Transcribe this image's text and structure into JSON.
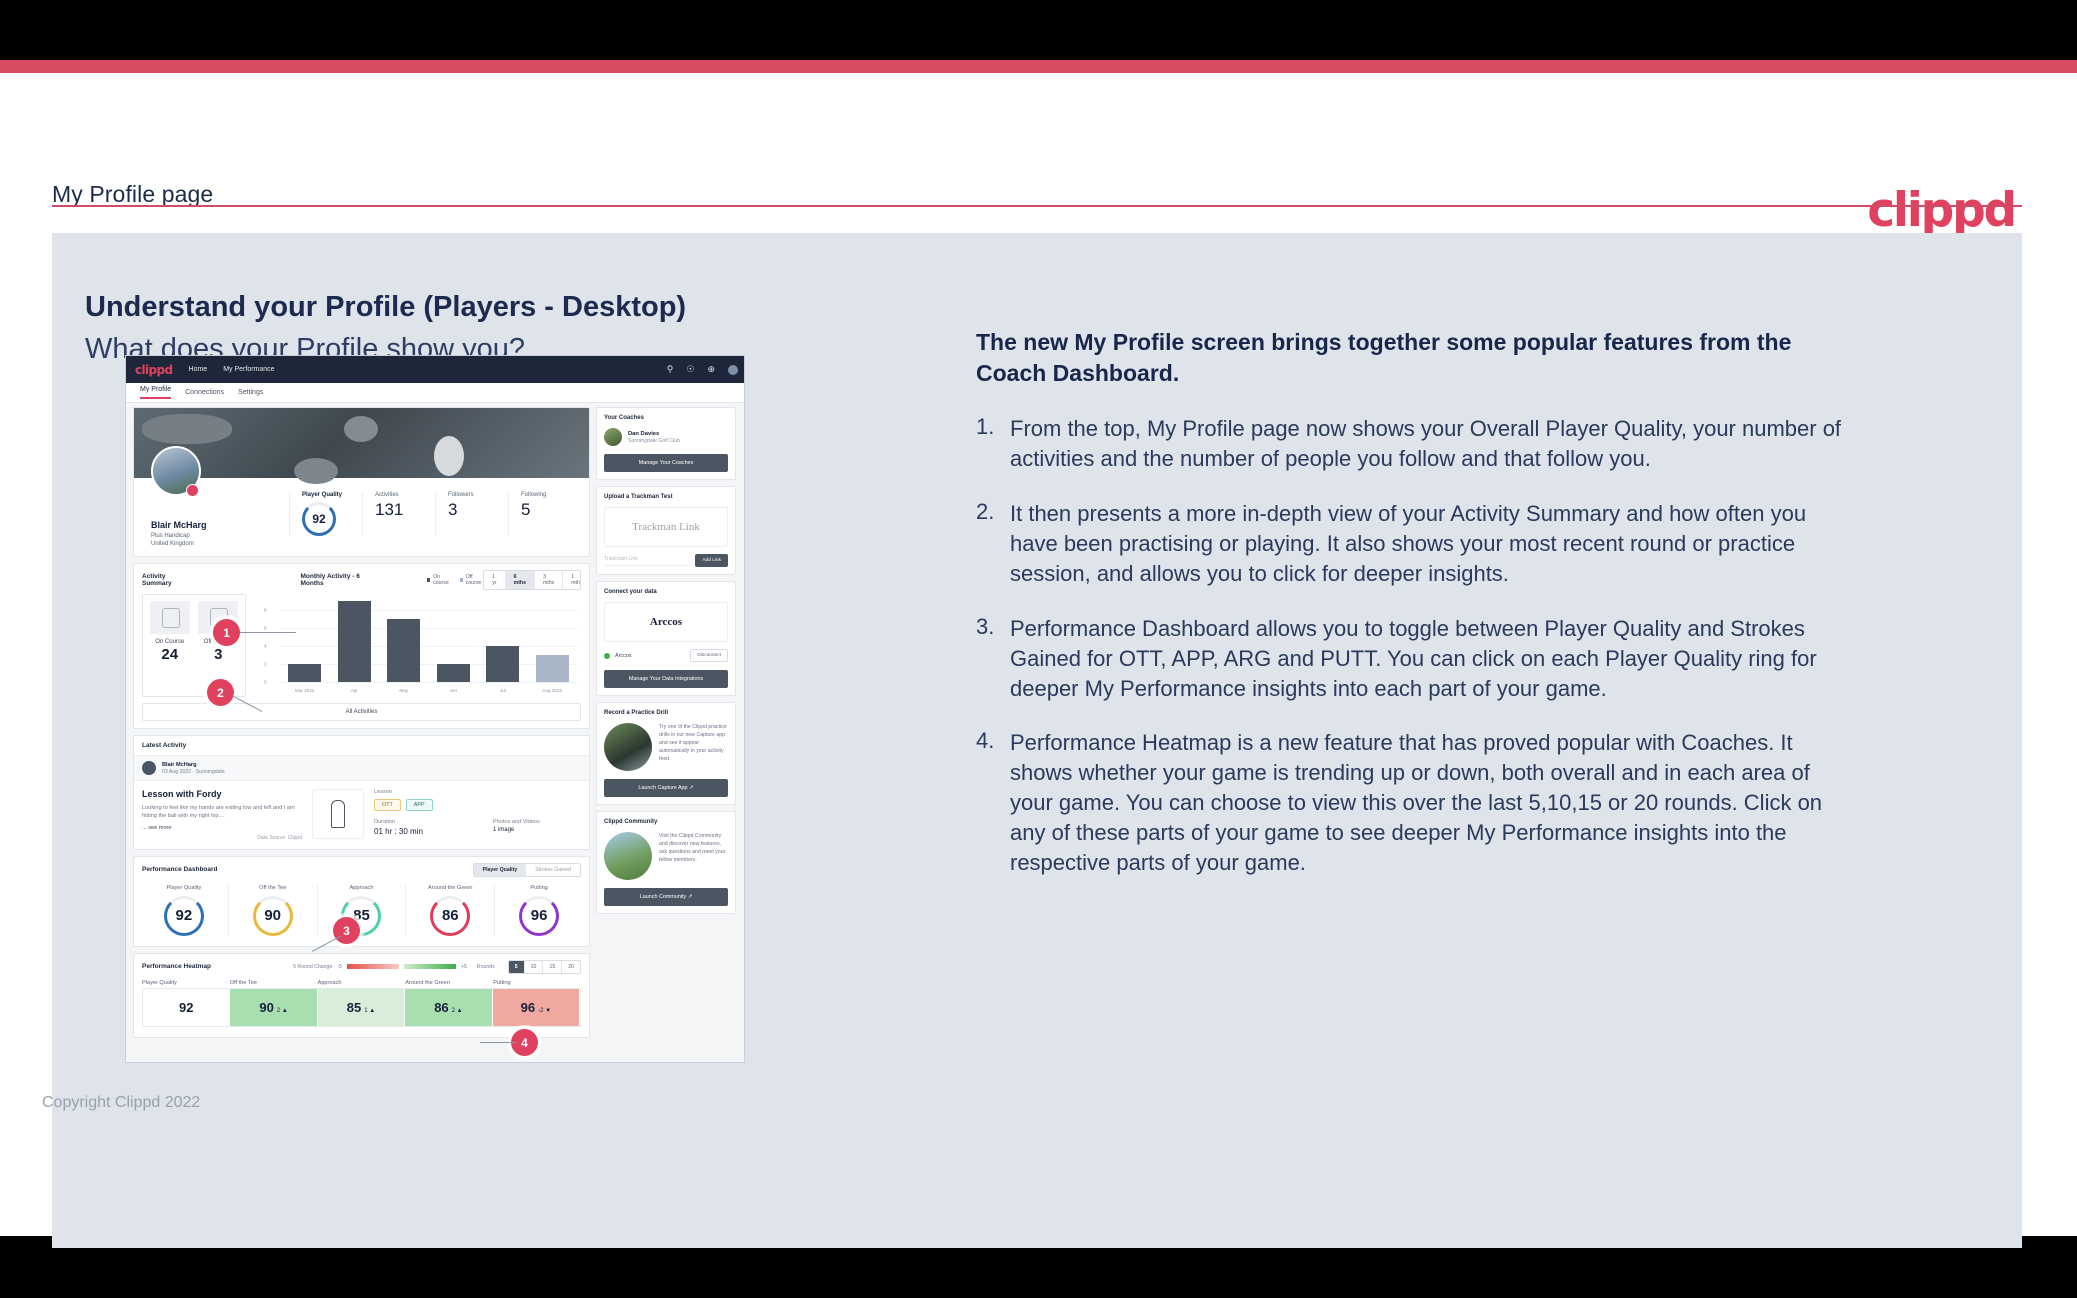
{
  "slide": {
    "header_title": "My Profile page",
    "logo": "clippd",
    "title": "Understand your Profile (Players - Desktop)",
    "subtitle": "What does your Profile show you?",
    "footer": "Copyright Clippd 2022"
  },
  "explainer": {
    "lead": "The new My Profile screen brings together some popular features from the Coach Dashboard.",
    "items": [
      {
        "num": "1.",
        "text": "From the top, My Profile page now shows your Overall Player Quality, your number of activities and the number of people you follow and that follow you."
      },
      {
        "num": "2.",
        "text": "It then presents a more in-depth view of your Activity Summary and how often you have been practising or playing. It also shows your most recent round or practice session, and allows you to click for deeper insights."
      },
      {
        "num": "3.",
        "text": "Performance Dashboard allows you to toggle between Player Quality and Strokes Gained for OTT, APP, ARG and PUTT. You can click on each Player Quality ring for deeper My Performance insights into each part of your game."
      },
      {
        "num": "4.",
        "text": "Performance Heatmap is a new feature that has proved popular with Coaches. It shows whether your game is trending up or down, both overall and in each area of your game. You can choose to view this over the last 5,10,15 or 20 rounds. Click on any of these parts of your game to see deeper My Performance insights into the respective parts of your game."
      }
    ]
  },
  "callouts": [
    "1",
    "2",
    "3",
    "4"
  ],
  "app": {
    "nav": {
      "logo": "clippd",
      "links": [
        "Home",
        "My Performance"
      ],
      "icons": [
        "search-icon",
        "community-icon",
        "add-circle-icon",
        "avatar-icon"
      ]
    },
    "tabs": [
      {
        "label": "My Profile",
        "active": true
      },
      {
        "label": "Connections",
        "active": false
      },
      {
        "label": "Settings",
        "active": false
      }
    ],
    "profile": {
      "name": "Blair McHarg",
      "handicap": "Plus Handicap",
      "location": "United Kingdom",
      "stats": [
        {
          "label": "Player Quality",
          "value": "92",
          "type": "ring",
          "color": "#2f6fb5"
        },
        {
          "label": "Activities",
          "value": "131",
          "type": "number"
        },
        {
          "label": "Followers",
          "value": "3",
          "type": "number"
        },
        {
          "label": "Following",
          "value": "5",
          "type": "number"
        }
      ]
    },
    "activity_summary": {
      "title": "Activity Summary",
      "chart_title": "Monthly Activity - 6 Months",
      "legend": [
        {
          "label": "On course",
          "color": "#4c5663"
        },
        {
          "label": "Off course",
          "color": "#a8b6c8"
        }
      ],
      "ranges": [
        {
          "label": "1 yr",
          "active": false
        },
        {
          "label": "6 mths",
          "active": true
        },
        {
          "label": "3 mths",
          "active": false
        },
        {
          "label": "1 mth",
          "active": false
        }
      ],
      "counters": [
        {
          "label": "On Course",
          "value": "24",
          "icon": "flag-green-icon"
        },
        {
          "label": "Off Course",
          "value": "3",
          "icon": "monitor-icon"
        }
      ],
      "all_activities_label": "All Activities"
    },
    "latest_activity": {
      "title": "Latest Activity",
      "user": "Blair McHarg",
      "meta": "03 Aug 2022 · Sunningdale",
      "activity_title": "Lesson with Fordy",
      "description": "Looking to feel like my hands are exiting low and left and I am hitting the ball with my right hip....",
      "see_more": "... see more",
      "data_source": "Data Source: Clippd",
      "lesson_label": "Lesson",
      "tags": [
        "OTT",
        "APP"
      ],
      "duration_label": "Duration",
      "duration_value": "01 hr : 30 min",
      "media_label": "Photos and Videos",
      "media_value": "1 image"
    },
    "performance_dashboard": {
      "title": "Performance Dashboard",
      "toggles": [
        {
          "label": "Player Quality",
          "active": true
        },
        {
          "label": "Strokes Gained",
          "active": false
        }
      ],
      "rings": [
        {
          "label": "Player Quality",
          "value": "92",
          "color": "#2f6fb5"
        },
        {
          "label": "Off the Tee",
          "value": "90",
          "color": "#e8b93c"
        },
        {
          "label": "Approach",
          "value": "85",
          "color": "#4fcfa8"
        },
        {
          "label": "Around the Green",
          "value": "86",
          "color": "#e03a57"
        },
        {
          "label": "Putting",
          "value": "96",
          "color": "#9234c9"
        }
      ]
    },
    "performance_heatmap": {
      "title": "Performance Heatmap",
      "change_label": "5 Round Change",
      "scale_min": "-5",
      "scale_max": "+5",
      "rounds_label": "Rounds",
      "rounds": [
        {
          "label": "5",
          "active": true
        },
        {
          "label": "10",
          "active": false
        },
        {
          "label": "15",
          "active": false
        },
        {
          "label": "20",
          "active": false
        }
      ],
      "cells": [
        {
          "label": "Player Quality",
          "value": "92",
          "delta": "",
          "bg": "#ffffff"
        },
        {
          "label": "Off the Tee",
          "value": "90",
          "delta": "2 ▲",
          "bg": "#a8dfb0"
        },
        {
          "label": "Approach",
          "value": "85",
          "delta": "1 ▲",
          "bg": "#d8eedb"
        },
        {
          "label": "Around the Green",
          "value": "86",
          "delta": "2 ▲",
          "bg": "#a8dfb0"
        },
        {
          "label": "Putting",
          "value": "96",
          "delta": "-2 ▼",
          "bg": "#f1a8a0"
        }
      ]
    },
    "sidebar": {
      "coaches": {
        "title": "Your Coaches",
        "coach_name": "Dan Davies",
        "coach_club": "Sunningdale Golf Club",
        "button": "Manage Your Coaches"
      },
      "trackman": {
        "title": "Upload a Trackman Test",
        "brand": "Trackman Link",
        "placeholder": "Trackman Link",
        "button": "Add Link"
      },
      "connect": {
        "title": "Connect your data",
        "brand": "Arccos",
        "source": "Arccos",
        "disconnect": "Disconnect",
        "button": "Manage Your Data Integrations"
      },
      "drill": {
        "title": "Record a Practice Drill",
        "text": "Try one of the Clippd practice drills in our new Capture app and see it appear automatically in your activity feed.",
        "button": "Launch Capture App ↗"
      },
      "community": {
        "title": "Clippd Community",
        "text": "Visit the Clippd Community and discover new features, ask questions and meet your fellow members.",
        "button": "Launch Community ↗"
      }
    }
  },
  "chart_data": {
    "type": "bar",
    "title": "Monthly Activity - 6 Months",
    "categories": [
      "Mar 2022",
      "Apr",
      "May",
      "Jun",
      "Jul",
      "Aug 2022"
    ],
    "values": [
      2,
      9,
      7,
      2,
      4,
      3
    ],
    "bar_colors": [
      "#4c5663",
      "#4c5663",
      "#4c5663",
      "#4c5663",
      "#4c5663",
      "#a8b6c8"
    ],
    "yticks": [
      "0",
      "2",
      "4",
      "6",
      "8"
    ],
    "ylim": [
      0,
      9.5
    ],
    "xlabel": "",
    "ylabel": "",
    "legend": [
      "On course",
      "Off course"
    ],
    "legend_position": "top-right",
    "grid": true
  }
}
